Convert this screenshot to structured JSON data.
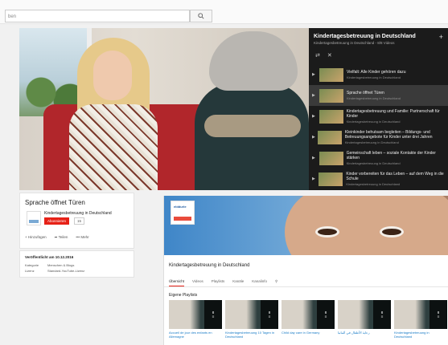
{
  "search": {
    "placeholder": "ben"
  },
  "player": {
    "playlist": {
      "title": "Kindertagesbetreuung in Deutschland",
      "subtitle": "Kindertagesbetreuung in Deutschland - 8/8 Videos",
      "plus": "+",
      "items": [
        {
          "title": "Vielfalt: Alle Kinder gehören dazu",
          "channel": "Kindertagesbetreuung in Deutschland",
          "active": false
        },
        {
          "title": "Sprache öffnet Türen",
          "channel": "Kindertagesbetreuung in Deutschland",
          "active": true
        },
        {
          "title": "Kindertagesbetreuung und Familie: Partnerschaft für Kinder",
          "channel": "Kindertagesbetreuung in Deutschland",
          "active": false
        },
        {
          "title": "Kleinkinder behutsam begleiten – Bildungs- und Betreuungsangebote für Kinder unter drei Jahren",
          "channel": "Kindertagesbetreuung in Deutschland",
          "active": false
        },
        {
          "title": "Gemeinschaft leben – soziale Kontakte der Kinder stärken",
          "channel": "Kindertagesbetreuung in Deutschland",
          "active": false
        },
        {
          "title": "Kinder vorbereiten für das Leben – auf dem Weg in die Schule",
          "channel": "Kindertagesbetreuung in Deutschland",
          "active": false
        }
      ]
    }
  },
  "video_info": {
    "title": "Sprache öffnet Türen",
    "channel_name": "Kindertagesbetreuung in Deutschland",
    "subscribe_label": "Abonnieren",
    "subscriber_count": "15",
    "actions": {
      "add": "Hinzufügen",
      "share": "Teilen",
      "more": "Mehr"
    }
  },
  "meta": {
    "published": "Veröffentlicht am 10.12.2016",
    "category_label": "Kategorie",
    "category_value": "Menschen & Blogs",
    "license_label": "Lizenz",
    "license_value": "Standard-YouTube-Lizenz"
  },
  "channel_page": {
    "logo_text": "elddurle",
    "title": "Kindertagesbetreuung in Deutschland",
    "tabs": [
      "Übersicht",
      "Videos",
      "Playlists",
      "Kanäle",
      "Kanalinfo"
    ],
    "active_tab": 0,
    "section_title": "Eigene Playlists",
    "playlists": [
      {
        "count": "8",
        "name": "Accueil de jour des enfants en Allemagne"
      },
      {
        "count": "8",
        "name": "Kindertagesbetreuung 10 Tagen in Deutschland"
      },
      {
        "count": "8",
        "name": "Child day care in Germany"
      },
      {
        "count": "8",
        "name": "رعاية الأطفال في ألمانيا"
      },
      {
        "count": "8",
        "name": "Kindertagesbetreuung in Deutschland"
      }
    ]
  },
  "colors": {
    "youtube_red": "#e62117",
    "link_blue": "#167ac6",
    "panel_dark": "#1b1b1b"
  }
}
